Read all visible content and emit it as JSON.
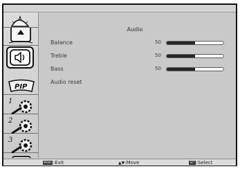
{
  "menu": {
    "title": "Audio",
    "rows": [
      {
        "label": "Balance",
        "value": "50",
        "level": 0.5
      },
      {
        "label": "Treble",
        "value": "50",
        "level": 0.5
      },
      {
        "label": "Bass",
        "value": "50",
        "level": 0.5
      },
      {
        "label": "Audio reset"
      }
    ]
  },
  "sidebar": {
    "items": [
      {
        "icon": "picture-icon"
      },
      {
        "icon": "screen-icon"
      },
      {
        "icon": "speaker-icon",
        "active": true
      },
      {
        "icon": "pip-icon",
        "label": "PIP"
      },
      {
        "icon": "configuration-1-icon",
        "number": "1"
      },
      {
        "icon": "configuration-2-icon",
        "number": "2"
      },
      {
        "icon": "configuration-3-icon",
        "number": "3"
      },
      {
        "icon": "advanced-option-icon"
      }
    ]
  },
  "footer": {
    "exit": {
      "key": "MENU",
      "label": ":Exit"
    },
    "move": {
      "key": "▲▼",
      "label": ":Move"
    },
    "select": {
      "key": "SET",
      "label": ":Select"
    }
  }
}
